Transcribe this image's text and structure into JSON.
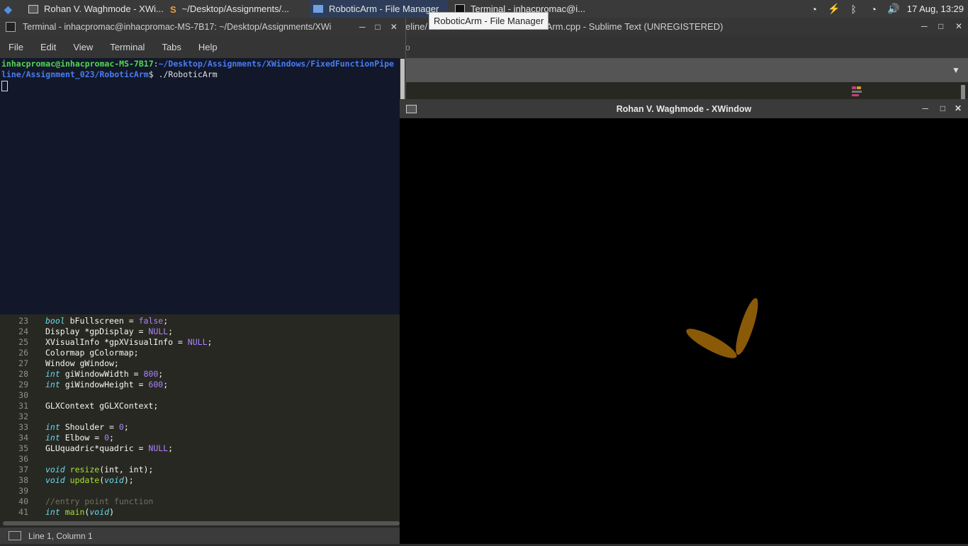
{
  "taskbar": {
    "tasks": [
      {
        "label": "Rohan V. Waghmode - XWi..."
      },
      {
        "label": "~/Desktop/Assignments/..."
      },
      {
        "label": "RoboticArm - File Manager"
      },
      {
        "label": "Terminal - inhacpromac@i..."
      }
    ],
    "clock": "17 Aug, 13:29"
  },
  "tooltip": "RoboticArm - File Manager",
  "sublime": {
    "title_partial": "eline/",
    "title_suffix": "/RoboticArm.cpp - Sublime Text (UNREGISTERED)",
    "menu_partial": "o",
    "status": "Line 1, Column 1"
  },
  "terminal": {
    "title": "Terminal - inhacpromac@inhacpromac-MS-7B17: ~/Desktop/Assignments/XWi",
    "menu": [
      "File",
      "Edit",
      "View",
      "Terminal",
      "Tabs",
      "Help"
    ],
    "prompt_user": "inhacpromac@inhacpromac-MS-7B17",
    "prompt_colon": ":",
    "prompt_path_1": "~/Desktop/Assignments/XWindows/FixedFunctionPipe",
    "prompt_path_2": "line/Assignment_023/RoboticArm",
    "prompt_dollar": "$ ",
    "command": "./RoboticArm"
  },
  "code_lines": [
    {
      "n": "23",
      "tokens": [
        [
          "kw",
          "bool"
        ],
        [
          "",
          " bFullscreen = "
        ],
        [
          "cst",
          "false"
        ],
        [
          "",
          ";"
        ]
      ]
    },
    {
      "n": "24",
      "tokens": [
        [
          "",
          "Display *gpDisplay = "
        ],
        [
          "cst",
          "NULL"
        ],
        [
          "",
          ";"
        ]
      ]
    },
    {
      "n": "25",
      "tokens": [
        [
          "",
          "XVisualInfo *gpXVisualInfo = "
        ],
        [
          "cst",
          "NULL"
        ],
        [
          "",
          ";"
        ]
      ]
    },
    {
      "n": "26",
      "tokens": [
        [
          "",
          "Colormap gColormap;"
        ]
      ]
    },
    {
      "n": "27",
      "tokens": [
        [
          "",
          "Window gWindow;"
        ]
      ]
    },
    {
      "n": "28",
      "tokens": [
        [
          "kw",
          "int"
        ],
        [
          "",
          " giWindowWidth = "
        ],
        [
          "cst",
          "800"
        ],
        [
          "",
          ";"
        ]
      ]
    },
    {
      "n": "29",
      "tokens": [
        [
          "kw",
          "int"
        ],
        [
          "",
          " giWindowHeight = "
        ],
        [
          "cst",
          "600"
        ],
        [
          "",
          ";"
        ]
      ]
    },
    {
      "n": "30",
      "tokens": []
    },
    {
      "n": "31",
      "tokens": [
        [
          "",
          "GLXContext gGLXContext;"
        ]
      ]
    },
    {
      "n": "32",
      "tokens": []
    },
    {
      "n": "33",
      "tokens": [
        [
          "kw",
          "int"
        ],
        [
          "",
          " Shoulder = "
        ],
        [
          "cst",
          "0"
        ],
        [
          "",
          ";"
        ]
      ]
    },
    {
      "n": "34",
      "tokens": [
        [
          "kw",
          "int"
        ],
        [
          "",
          " Elbow = "
        ],
        [
          "cst",
          "0"
        ],
        [
          "",
          ";"
        ]
      ]
    },
    {
      "n": "35",
      "tokens": [
        [
          "",
          "GLUquadric*quadric = "
        ],
        [
          "cst",
          "NULL"
        ],
        [
          "",
          ";"
        ]
      ]
    },
    {
      "n": "36",
      "tokens": []
    },
    {
      "n": "37",
      "tokens": [
        [
          "kw",
          "void"
        ],
        [
          "",
          " "
        ],
        [
          "fn",
          "resize"
        ],
        [
          "",
          "(int, int);"
        ]
      ]
    },
    {
      "n": "38",
      "tokens": [
        [
          "kw",
          "void"
        ],
        [
          "",
          " "
        ],
        [
          "fn",
          "update"
        ],
        [
          "",
          "("
        ],
        [
          "kw",
          "void"
        ],
        [
          "",
          ");"
        ]
      ]
    },
    {
      "n": "39",
      "tokens": []
    },
    {
      "n": "40",
      "tokens": [
        [
          "cm",
          "//entry point function"
        ]
      ]
    },
    {
      "n": "41",
      "tokens": [
        [
          "kw",
          "int"
        ],
        [
          "",
          " "
        ],
        [
          "fn",
          "main"
        ],
        [
          "",
          "("
        ],
        [
          "kw",
          "void"
        ],
        [
          "",
          ")"
        ]
      ]
    }
  ],
  "xwindow": {
    "title": "Rohan V. Waghmode - XWindow",
    "arm_color": "#8a5a08"
  }
}
